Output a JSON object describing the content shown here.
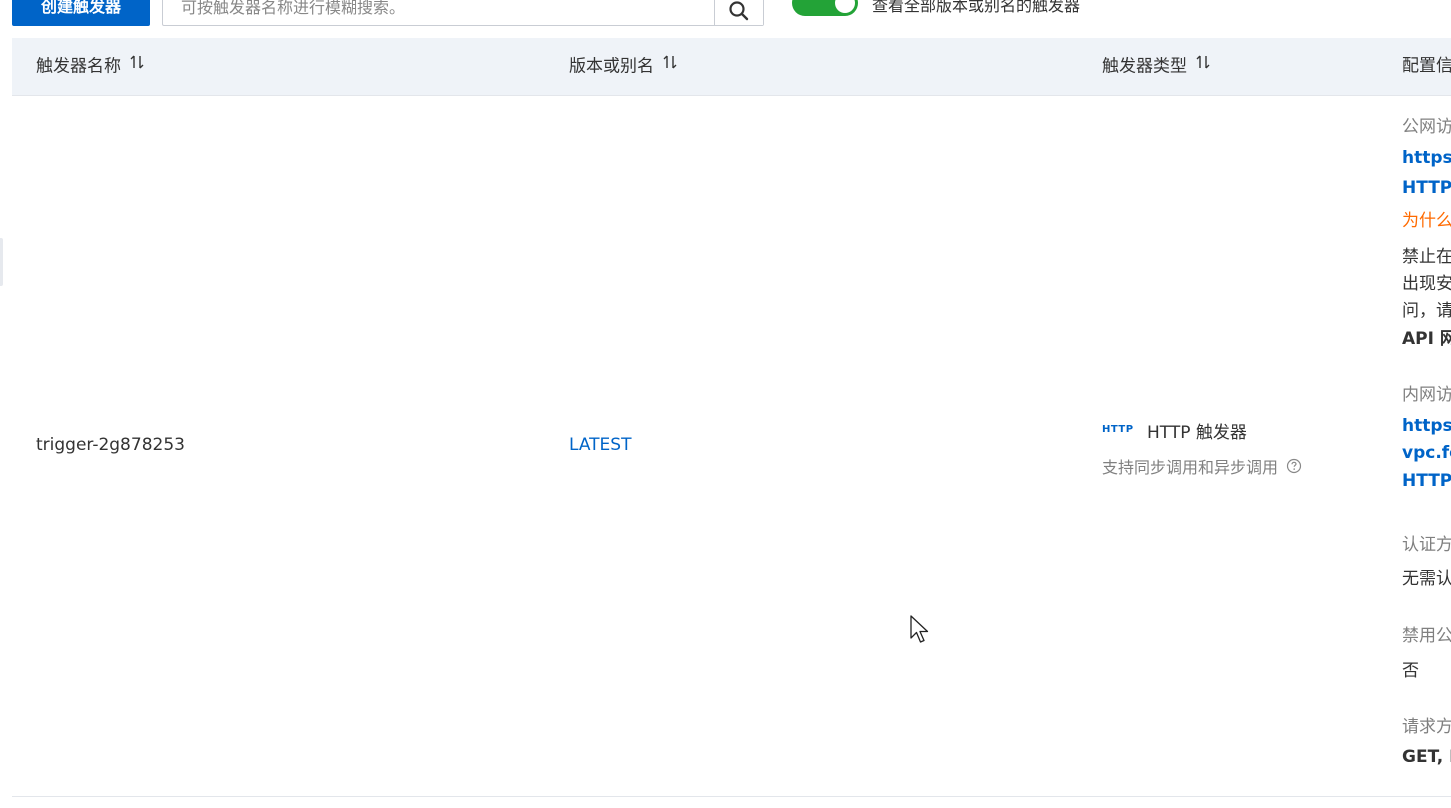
{
  "toolbar": {
    "create_button_label": "创建触发器",
    "search_placeholder": "可按触发器名称进行模糊搜索。",
    "search_icon": "search-icon",
    "toggle_on": true,
    "toggle_label": "查看全部版本或别名的触发器",
    "accent_color": "#0064c8",
    "toggle_color": "#23a337"
  },
  "table": {
    "columns": [
      {
        "label": "触发器名称",
        "sort_icon": "sort-icon"
      },
      {
        "label": "版本或别名",
        "sort_icon": "sort-icon"
      },
      {
        "label": "触发器类型",
        "sort_icon": "sort-icon"
      },
      {
        "label": "配置信"
      }
    ],
    "rows": [
      {
        "name": "trigger-2g878253",
        "version": "LATEST",
        "type_badge": "HTTP",
        "type_name": "HTTP 触发器",
        "type_desc": "支持同步调用和异步调用",
        "type_help_icon": "help-circle-icon",
        "config": {
          "public_label": "公网访",
          "public_url": "https:/",
          "public_https": "HTTPS",
          "why_link": "为什么",
          "warn_lines": [
            "禁止在",
            "出现安",
            "问，请",
            "API 网"
          ],
          "internal_label": "内网访",
          "internal_url_lines": [
            "https:/",
            "vpc.fc",
            "HTTPS"
          ],
          "auth_label": "认证方",
          "auth_value": "无需认",
          "disable_label": "禁用公",
          "disable_value": "否",
          "method_label": "请求方",
          "method_value": "GET, P"
        }
      }
    ]
  },
  "colors": {
    "header_bg": "#eff3f8",
    "label_gray": "#808080",
    "warning_orange": "#ff6a00"
  }
}
